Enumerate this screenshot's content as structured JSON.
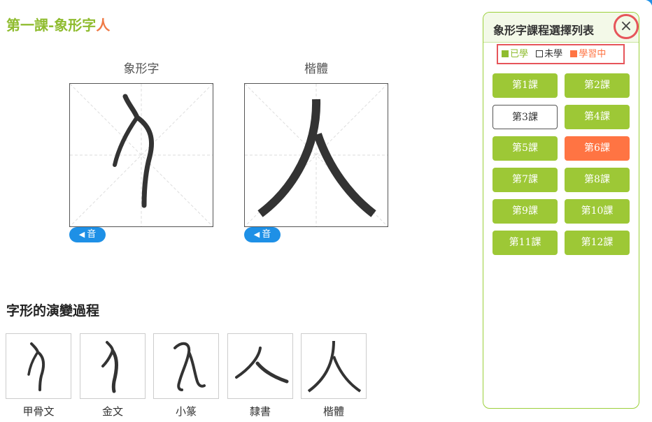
{
  "header": {
    "title_prefix": "第一課-象形字",
    "title_char": "人"
  },
  "panels": [
    {
      "label": "象形字",
      "audio_label": "音"
    },
    {
      "label": "楷體",
      "audio_label": "音"
    }
  ],
  "evolution": {
    "title": "字形的演變過程",
    "items": [
      {
        "label": "甲骨文"
      },
      {
        "label": "金文"
      },
      {
        "label": "小篆"
      },
      {
        "label": "隸書"
      },
      {
        "label": "楷體"
      }
    ]
  },
  "sidebar": {
    "title": "象形字課程選擇列表",
    "close_symbol": "×",
    "legend": [
      {
        "label": "已學",
        "color": "#8fbc2f",
        "state": "done"
      },
      {
        "label": "未學",
        "color": "#333333",
        "state": "todo"
      },
      {
        "label": "學習中",
        "color": "#ff7443",
        "state": "current"
      }
    ],
    "lessons": [
      {
        "label": "第1課",
        "state": "done"
      },
      {
        "label": "第2課",
        "state": "done"
      },
      {
        "label": "第3課",
        "state": "todo"
      },
      {
        "label": "第4課",
        "state": "done"
      },
      {
        "label": "第5課",
        "state": "done"
      },
      {
        "label": "第6課",
        "state": "current"
      },
      {
        "label": "第7課",
        "state": "done"
      },
      {
        "label": "第8課",
        "state": "done"
      },
      {
        "label": "第9課",
        "state": "done"
      },
      {
        "label": "第10課",
        "state": "done"
      },
      {
        "label": "第11課",
        "state": "done"
      },
      {
        "label": "第12課",
        "state": "done"
      }
    ]
  },
  "colors": {
    "accent_green": "#9dc836",
    "accent_orange": "#ff7443",
    "audio_blue": "#1e90e6",
    "highlight_red": "#e6555a"
  }
}
